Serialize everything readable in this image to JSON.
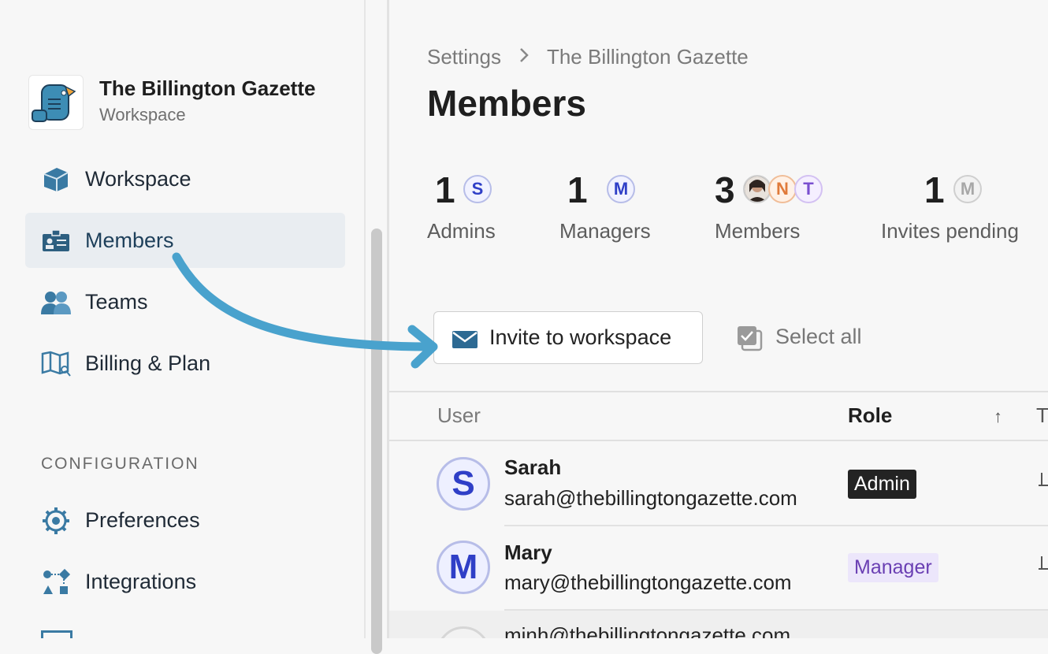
{
  "workspace": {
    "name": "The Billington Gazette",
    "subtitle": "Workspace"
  },
  "sidebar": {
    "items": [
      {
        "label": "Workspace",
        "icon": "workspace-icon"
      },
      {
        "label": "Members",
        "icon": "id-card-icon",
        "active": true
      },
      {
        "label": "Teams",
        "icon": "teams-icon"
      },
      {
        "label": "Billing & Plan",
        "icon": "map-icon"
      }
    ],
    "section_title": "CONFIGURATION",
    "config_items": [
      {
        "label": "Preferences",
        "icon": "gear-icon"
      },
      {
        "label": "Integrations",
        "icon": "integrations-icon"
      }
    ]
  },
  "breadcrumb": {
    "root": "Settings",
    "current": "The Billington Gazette"
  },
  "page": {
    "title": "Members"
  },
  "stats": [
    {
      "count": "1",
      "label": "Admins",
      "avatars": [
        "S"
      ]
    },
    {
      "count": "1",
      "label": "Managers",
      "avatars": [
        "M"
      ]
    },
    {
      "count": "3",
      "label": "Members",
      "avatars": [
        "N",
        "T"
      ]
    },
    {
      "count": "1",
      "label": "Invites pending",
      "avatars": [
        "M"
      ]
    }
  ],
  "actions": {
    "invite_label": "Invite to workspace",
    "select_all_label": "Select all"
  },
  "table": {
    "headers": {
      "user": "User",
      "role": "Role",
      "sort": "↑",
      "extra": "T"
    },
    "rows": [
      {
        "initial": "S",
        "name": "Sarah",
        "email": "sarah@thebillingtongazette.com",
        "role": "Admin"
      },
      {
        "initial": "M",
        "name": "Mary",
        "email": "mary@thebillingtongazette.com",
        "role": "Manager"
      },
      {
        "initial": "",
        "name": "",
        "email": "minh@thebillingtongazette.com",
        "role": ""
      }
    ]
  },
  "colors": {
    "accent": "#3a9cc8",
    "active_bg": "#e9edf1",
    "avatar_blue": "#2f3fc7",
    "avatar_orange": "#e07a3a",
    "avatar_purple": "#7a4fd0",
    "admin_badge": "#232323",
    "manager_badge": "#ece6fb"
  }
}
